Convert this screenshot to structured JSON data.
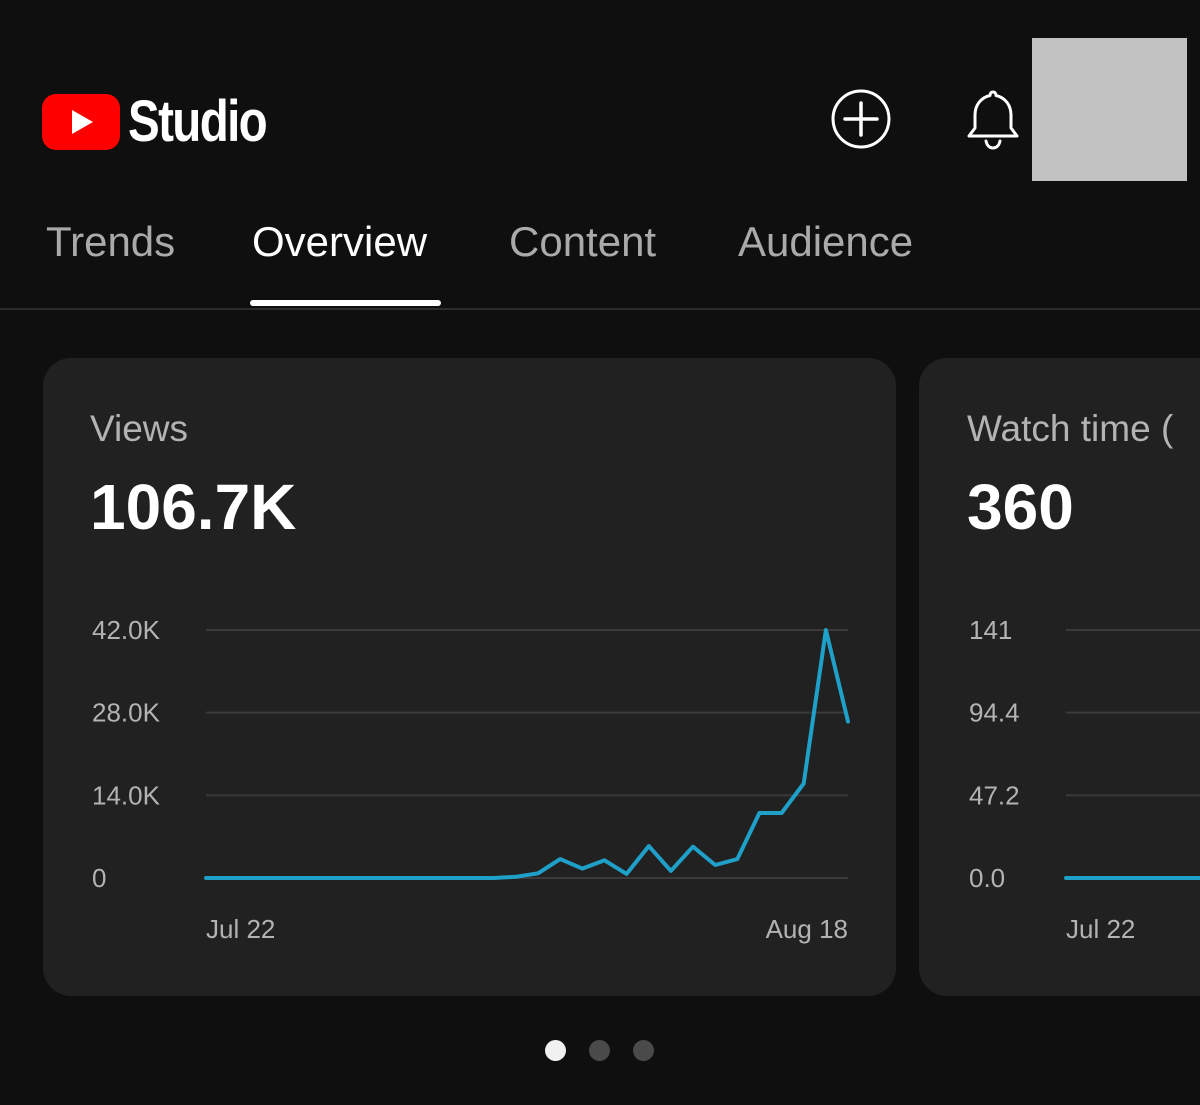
{
  "header": {
    "brand_label": "Studio",
    "icons": {
      "logo": "youtube-play-icon",
      "create": "plus-circle-icon",
      "notifications": "bell-icon",
      "avatar": "avatar"
    }
  },
  "tabs": [
    {
      "label": "Trends",
      "active": false
    },
    {
      "label": "Overview",
      "active": true
    },
    {
      "label": "Content",
      "active": false
    },
    {
      "label": "Audience",
      "active": false
    }
  ],
  "cards": [
    {
      "metric_label": "Views",
      "metric_value": "106.7K"
    },
    {
      "metric_label": "Watch time (",
      "metric_value": "360"
    }
  ],
  "colors": {
    "accent_line": "#1fa0c9",
    "brand_red": "#ff0000",
    "background": "#0f0f0f",
    "card": "#212121"
  },
  "pagination": {
    "count": 3,
    "active_index": 0
  },
  "chart_data": [
    {
      "type": "line",
      "series": [
        {
          "values": [
            0,
            0,
            0,
            0,
            0,
            0,
            0,
            0,
            0,
            0,
            0,
            0,
            0,
            0,
            200,
            800,
            3200,
            1600,
            3000,
            700,
            5400,
            1200,
            5300,
            2200,
            3200,
            11000,
            11000,
            16000,
            42000,
            26500
          ]
        }
      ],
      "x_tick_labels": [
        "Jul 22",
        "Aug 18"
      ],
      "y_tick_labels": [
        "42.0K",
        "28.0K",
        "14.0K",
        "0"
      ],
      "ylim": [
        0,
        42000
      ],
      "grid": true
    },
    {
      "type": "line",
      "series": [
        {
          "values": [
            0,
            0,
            0
          ]
        }
      ],
      "x_tick_labels": [
        "Jul 22"
      ],
      "y_tick_labels": [
        "141",
        "94.4",
        "47.2",
        "0.0"
      ],
      "ylim": [
        0,
        141
      ],
      "grid": true
    }
  ]
}
